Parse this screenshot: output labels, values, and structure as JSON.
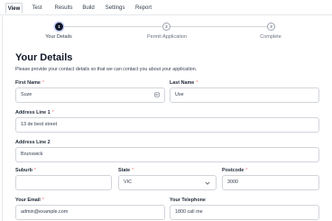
{
  "nav": {
    "tabs": [
      {
        "label": "View"
      },
      {
        "label": "Test"
      },
      {
        "label": "Results"
      },
      {
        "label": "Build"
      },
      {
        "label": "Settings"
      },
      {
        "label": "Report"
      }
    ],
    "active_tab": "View"
  },
  "stepper": {
    "steps": [
      {
        "number": "1",
        "label": "Your Details",
        "state": "active"
      },
      {
        "number": "2",
        "label": "Permit Application",
        "state": "inactive"
      },
      {
        "number": "3",
        "label": "Complete",
        "state": "inactive"
      }
    ]
  },
  "form": {
    "title": "Your Details",
    "intro": "Please provide your contact details so that we can contact you about your application.",
    "required_mark": "*",
    "first_name": {
      "label": "First Name",
      "value": "Suze"
    },
    "last_name": {
      "label": "Last Name",
      "value": "Use"
    },
    "address1": {
      "label": "Address Line 1",
      "value": "13 de best street"
    },
    "address2": {
      "label": "Address Line 2",
      "value": "Brunswick"
    },
    "suburb": {
      "label": "Suburb",
      "value": ""
    },
    "state": {
      "label": "State",
      "value": "VIC"
    },
    "postcode": {
      "label": "Postcode",
      "value": "3000"
    },
    "email": {
      "label": "Your Email",
      "value": "admin@example.com"
    },
    "telephone": {
      "label": "Your Telephone",
      "value": "1800 call me"
    }
  },
  "colors": {
    "accent": "#111827",
    "required": "#f87171",
    "border": "#d1d5db"
  }
}
